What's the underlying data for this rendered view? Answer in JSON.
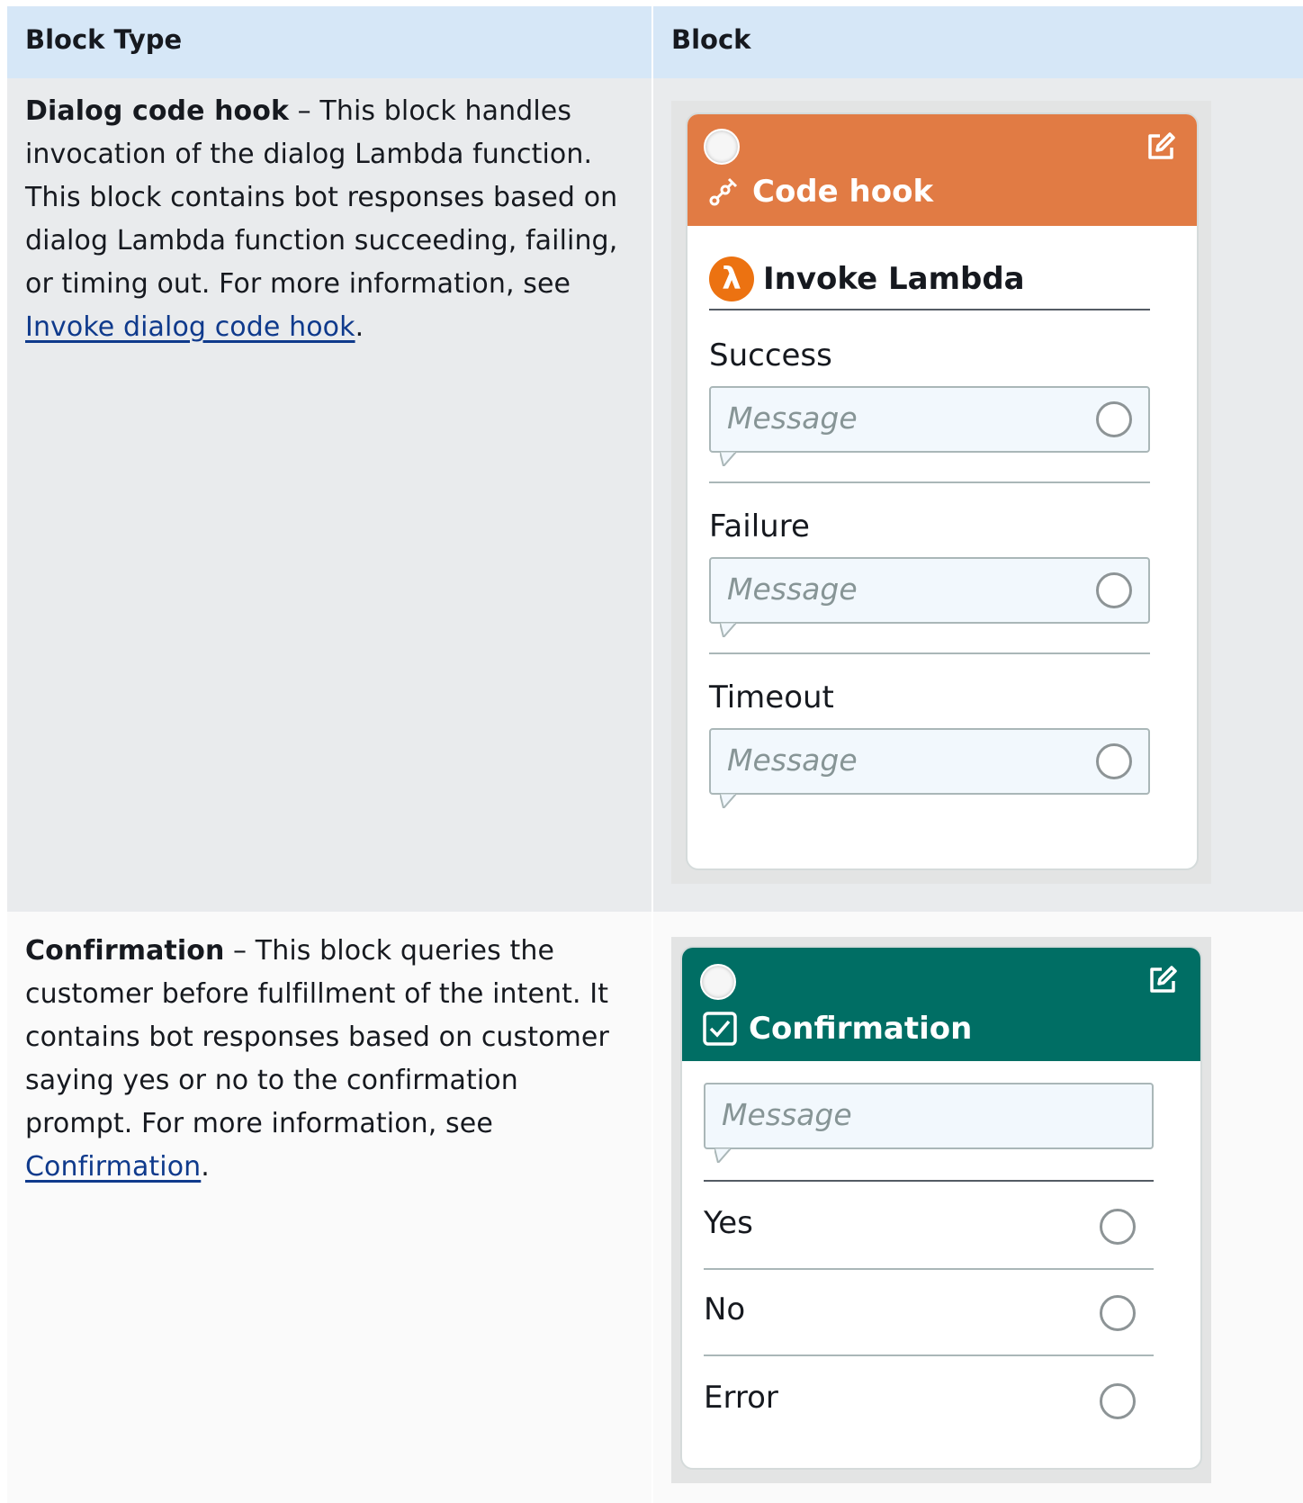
{
  "table": {
    "headers": {
      "block_type": "Block Type",
      "block": "Block"
    },
    "rows": [
      {
        "name": "Dialog code hook",
        "description_pre": " – This block handles invocation of the dialog Lambda function. This block contains bot responses based on dialog Lambda function succeeding, failing, or timing out. For more information, see ",
        "link": "Invoke dialog code hook",
        "description_post": ".",
        "block": {
          "header_title": "Code hook",
          "header_color": "#e17b44",
          "header_icon": "code-hook-icon",
          "invoke_label": "Invoke Lambda",
          "invoke_icon": "lambda-icon",
          "invoke_glyph": "λ",
          "sections": [
            {
              "label": "Success",
              "placeholder": "Message"
            },
            {
              "label": "Failure",
              "placeholder": "Message"
            },
            {
              "label": "Timeout",
              "placeholder": "Message"
            }
          ]
        }
      },
      {
        "name": "Confirmation",
        "description_pre": " – This block queries the customer before fulfillment of the intent. It contains bot responses based on customer saying yes or no to the confirmation prompt. For more information, see ",
        "link": "Confirmation",
        "description_post": ".",
        "block": {
          "header_title": "Confirmation",
          "header_color": "#006e64",
          "header_icon": "checkbox-icon",
          "placeholder": "Message",
          "options": [
            "Yes",
            "No",
            "Error"
          ]
        }
      }
    ]
  },
  "colors": {
    "header_row": "#d6e7f7",
    "row1_bg": "#e9ebed",
    "row2_bg": "#fafafa",
    "link": "#0f3a8c",
    "message_box": "#f2f8fd"
  }
}
